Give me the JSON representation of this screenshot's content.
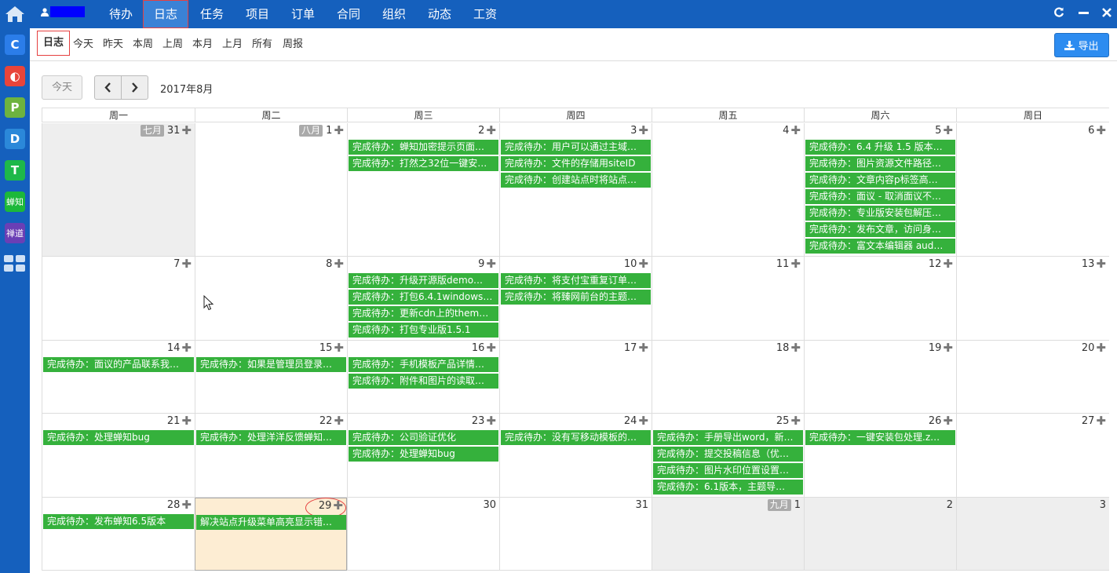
{
  "sidebar": {
    "home_icon": "home-icon",
    "apps": [
      {
        "label": "C",
        "color": "#2b7de9"
      },
      {
        "label": "◐",
        "color": "#e8443a"
      },
      {
        "label": "P",
        "color": "#6db33f"
      },
      {
        "label": "D",
        "color": "#2b88d9"
      },
      {
        "label": "T",
        "color": "#1eb84a"
      },
      {
        "label": "蝉知",
        "color": "#1cb83a"
      },
      {
        "label": "禅道",
        "color": "#6a3fb5"
      }
    ]
  },
  "topnav": {
    "items": [
      "待办",
      "日志",
      "任务",
      "项目",
      "订单",
      "合同",
      "组织",
      "动态",
      "工资"
    ],
    "active": "日志"
  },
  "subnav": {
    "items": [
      "日志",
      "今天",
      "昨天",
      "本周",
      "上周",
      "本月",
      "上月",
      "所有",
      "周报"
    ],
    "active": "日志",
    "export_label": "导出"
  },
  "toolbar": {
    "today_label": "今天",
    "month_title": "2017年8月"
  },
  "calendar": {
    "weekdays": [
      "周一",
      "周二",
      "周三",
      "周四",
      "周五",
      "周六",
      "周日"
    ],
    "weeks": [
      [
        {
          "day": "31",
          "badge": "七月",
          "other": true,
          "plus": true,
          "events": []
        },
        {
          "day": "1",
          "badge": "八月",
          "plus": true,
          "events": []
        },
        {
          "day": "2",
          "plus": true,
          "events": [
            "完成待办：蝉知加密提示页面…",
            "完成待办：打然之32位一键安…"
          ]
        },
        {
          "day": "3",
          "plus": true,
          "events": [
            "完成待办：用户可以通过主域…",
            "完成待办：文件的存储用siteID",
            "完成待办：创建站点时将站点…"
          ]
        },
        {
          "day": "4",
          "plus": true,
          "events": []
        },
        {
          "day": "5",
          "plus": true,
          "events": [
            "完成待办：6.4 升级 1.5 版本…",
            "完成待办：图片资源文件路径…",
            "完成待办：文章内容p标签高…",
            "完成待办：面议 - 取消面议不…",
            "完成待办：专业版安装包解压…",
            "完成待办：发布文章，访问身…",
            "完成待办：富文本编辑器 aud…"
          ]
        },
        {
          "day": "6",
          "plus": true,
          "events": []
        }
      ],
      [
        {
          "day": "7",
          "plus": true,
          "events": []
        },
        {
          "day": "8",
          "plus": true,
          "events": []
        },
        {
          "day": "9",
          "plus": true,
          "events": [
            "完成待办：升级开源版demo…",
            "完成待办：打包6.4.1windows…",
            "完成待办：更新cdn上的them…",
            "完成待办：打包专业版1.5.1"
          ]
        },
        {
          "day": "10",
          "plus": true,
          "events": [
            "完成待办：将支付宝重复订单…",
            "完成待办：将臻网前台的主题…"
          ]
        },
        {
          "day": "11",
          "plus": true,
          "events": []
        },
        {
          "day": "12",
          "plus": true,
          "events": []
        },
        {
          "day": "13",
          "plus": true,
          "events": []
        }
      ],
      [
        {
          "day": "14",
          "plus": true,
          "events": [
            "完成待办：面议的产品联系我…"
          ]
        },
        {
          "day": "15",
          "plus": true,
          "events": [
            "完成待办：如果是管理员登录…"
          ]
        },
        {
          "day": "16",
          "plus": true,
          "events": [
            "完成待办：手机模板产品详情…",
            "完成待办：附件和图片的读取…"
          ]
        },
        {
          "day": "17",
          "plus": true,
          "events": []
        },
        {
          "day": "18",
          "plus": true,
          "events": []
        },
        {
          "day": "19",
          "plus": true,
          "events": []
        },
        {
          "day": "20",
          "plus": true,
          "events": []
        }
      ],
      [
        {
          "day": "21",
          "plus": true,
          "events": [
            "完成待办：处理蝉知bug"
          ]
        },
        {
          "day": "22",
          "plus": true,
          "events": [
            "完成待办：处理洋洋反馈蝉知…"
          ]
        },
        {
          "day": "23",
          "plus": true,
          "events": [
            "完成待办：公司验证优化",
            "完成待办：处理蝉知bug"
          ]
        },
        {
          "day": "24",
          "plus": true,
          "events": [
            "完成待办：没有写移动模板的…"
          ]
        },
        {
          "day": "25",
          "plus": true,
          "events": [
            "完成待办：手册导出word，新…",
            "完成待办：提交投稿信息（优…",
            "完成待办：图片水印位置设置…",
            "完成待办：6.1版本，主题导…"
          ]
        },
        {
          "day": "26",
          "plus": true,
          "events": [
            "完成待办：一键安装包处理.z…"
          ]
        },
        {
          "day": "27",
          "plus": true,
          "events": []
        }
      ],
      [
        {
          "day": "28",
          "plus": true,
          "events": [
            "完成待办：发布蝉知6.5版本"
          ]
        },
        {
          "day": "29",
          "plus": true,
          "today": true,
          "events": [
            "解决站点升级菜单高亮显示错…"
          ]
        },
        {
          "day": "30",
          "plus": false,
          "events": []
        },
        {
          "day": "31",
          "plus": false,
          "events": []
        },
        {
          "day": "1",
          "badge": "九月",
          "other": true,
          "plus": false,
          "events": []
        },
        {
          "day": "2",
          "other": true,
          "plus": false,
          "events": []
        },
        {
          "day": "3",
          "other": true,
          "plus": false,
          "events": []
        }
      ]
    ]
  }
}
